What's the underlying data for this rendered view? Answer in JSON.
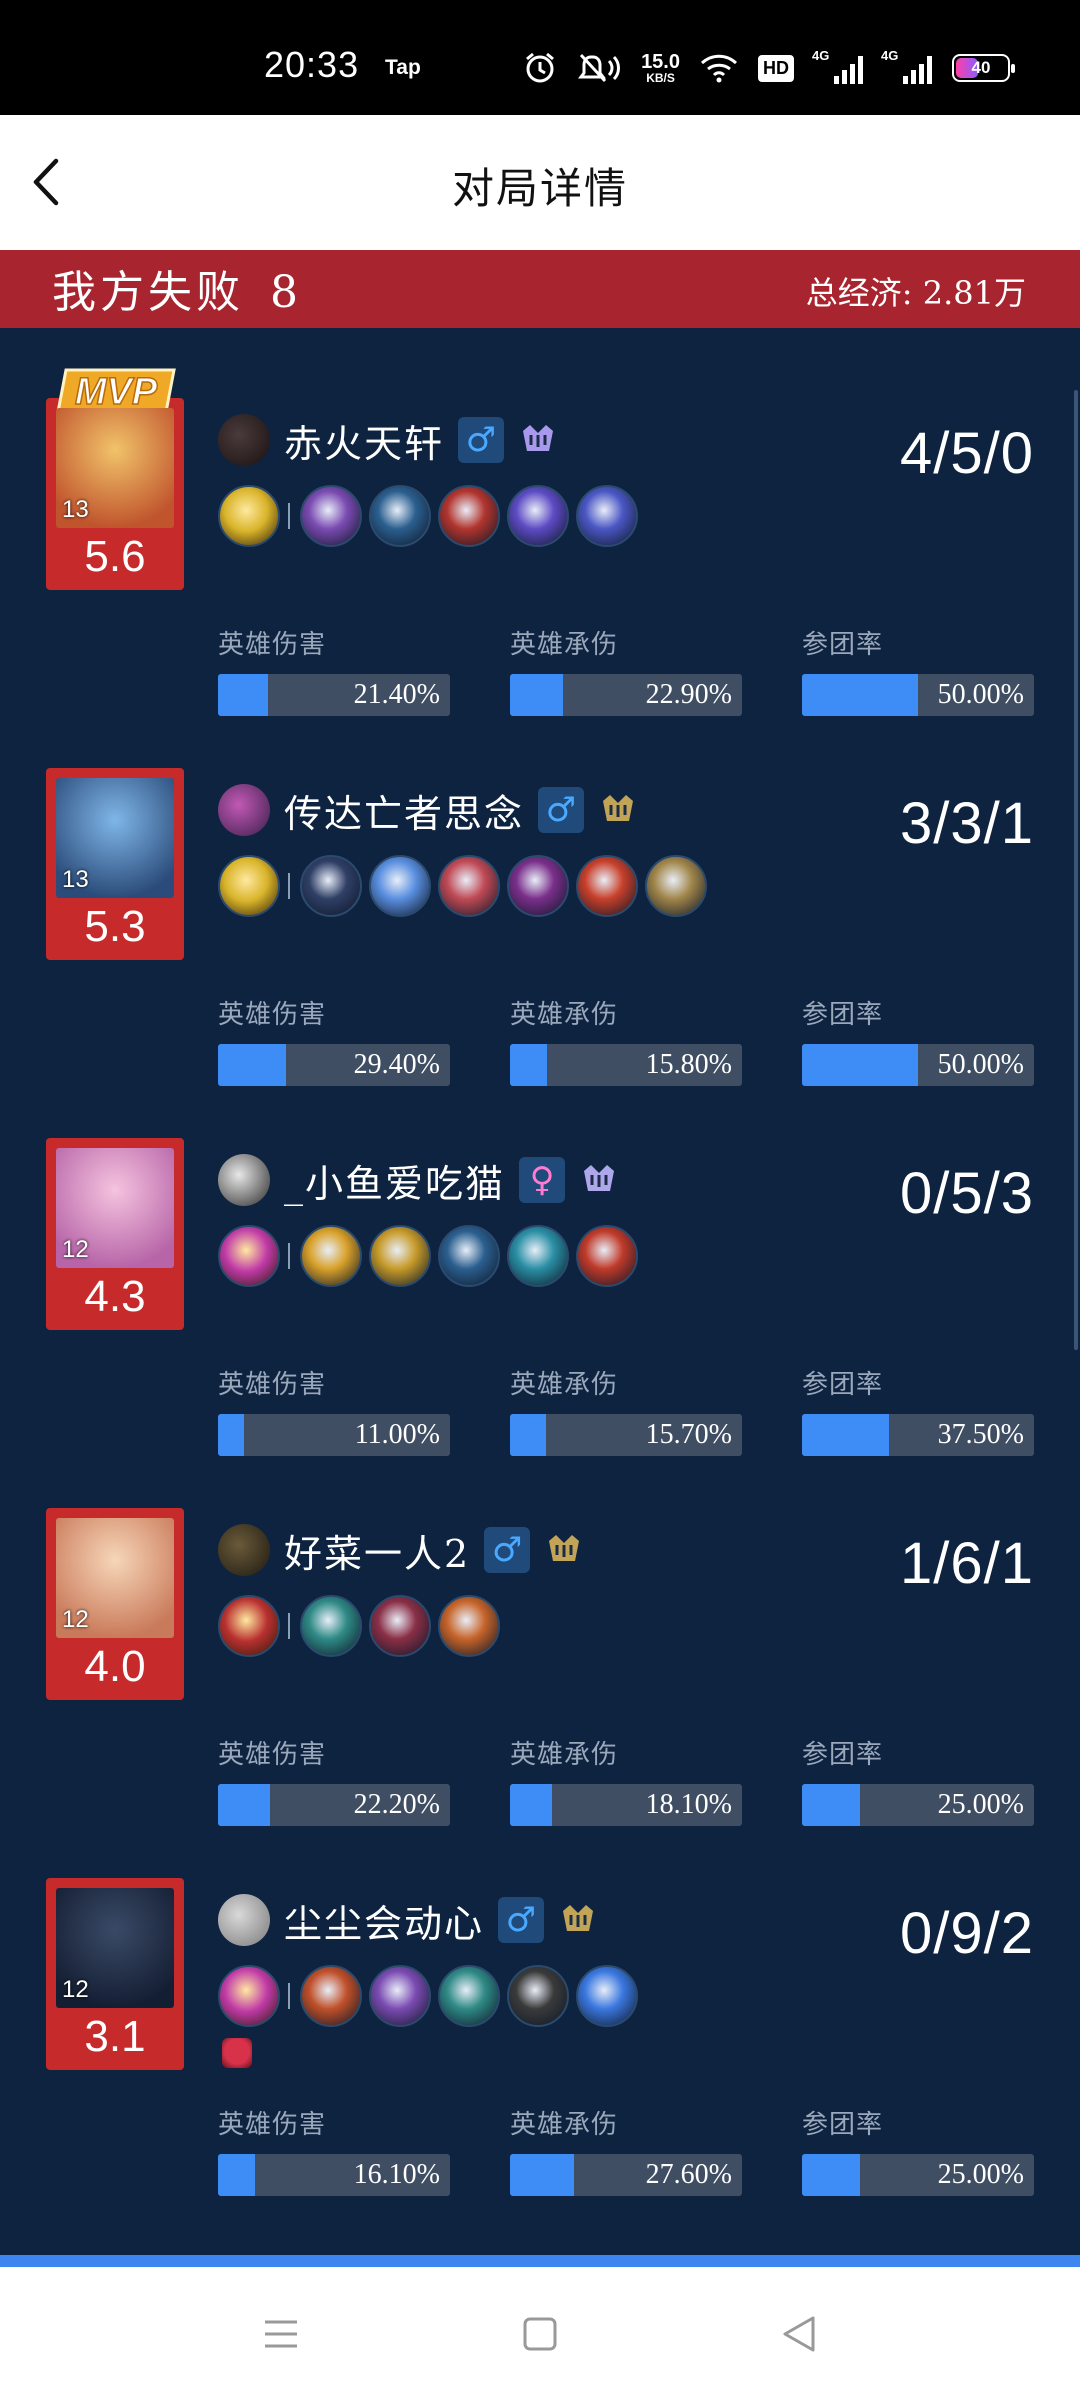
{
  "status_bar": {
    "time": "20:33",
    "app_badge": "Tap",
    "speed_value": "15.0",
    "speed_unit": "KB/S",
    "hd": "HD",
    "net1": "4G",
    "net2": "4G",
    "battery": "40"
  },
  "header": {
    "title": "对局详情"
  },
  "result": {
    "label": "我方失败",
    "count": "8",
    "economy": "总经济: 2.81万"
  },
  "stat_labels": {
    "damage": "英雄伤害",
    "taken": "英雄承伤",
    "participation": "参团率"
  },
  "mvp_label": "MVP",
  "players": [
    {
      "name": "赤火天轩",
      "gender": "♂",
      "gender_type": "male",
      "level": "13",
      "score": "5.6",
      "kda": "4/5/0",
      "mvp": true,
      "hero_colors": [
        "#f1c36a",
        "#c0542d"
      ],
      "avatar_colors": [
        "#4a3b3b",
        "#1a1010"
      ],
      "rank_color": "#b9a6ff",
      "spell": "#d9b42a",
      "items": [
        "#7b4bb2",
        "#2b5f8f",
        "#b2352e",
        "#5d4bc4",
        "#4b57c4"
      ],
      "damage": "21.40%",
      "damage_pct": 0.214,
      "taken": "22.90%",
      "taken_pct": 0.229,
      "participation": "50.00%",
      "participation_pct": 0.5
    },
    {
      "name": "传达亡者思念",
      "gender": "♂",
      "gender_type": "male",
      "level": "13",
      "score": "5.3",
      "kda": "3/3/1",
      "mvp": false,
      "hero_colors": [
        "#7fb6e8",
        "#2b4c7a"
      ],
      "avatar_colors": [
        "#c259b5",
        "#3a1f4a"
      ],
      "rank_color": "#d6b35a",
      "spell": "#d9b42a",
      "items": [
        "#2f3f66",
        "#5a8fe0",
        "#c04a55",
        "#7a2f8a",
        "#c8402b",
        "#a1864a"
      ],
      "damage": "29.40%",
      "damage_pct": 0.294,
      "taken": "15.80%",
      "taken_pct": 0.158,
      "participation": "50.00%",
      "participation_pct": 0.5
    },
    {
      "name": "_小鱼爱吃猫",
      "gender": "♀",
      "gender_type": "female",
      "level": "12",
      "score": "4.3",
      "kda": "0/5/3",
      "mvp": false,
      "hero_colors": [
        "#f5c3df",
        "#b765a8"
      ],
      "avatar_colors": [
        "#e8e8e8",
        "#2a2a2a"
      ],
      "rank_color": "#c0b6ff",
      "spell": "#c03aa7",
      "items": [
        "#d9a12a",
        "#c79b2a",
        "#2b5f8f",
        "#2a8fa5",
        "#c03a2a"
      ],
      "damage": "11.00%",
      "damage_pct": 0.11,
      "taken": "15.70%",
      "taken_pct": 0.157,
      "participation": "37.50%",
      "participation_pct": 0.375
    },
    {
      "name": "好菜一人2",
      "gender": "♂",
      "gender_type": "male",
      "level": "12",
      "score": "4.0",
      "kda": "1/6/1",
      "mvp": false,
      "hero_colors": [
        "#f6d6b8",
        "#c97a5a"
      ],
      "avatar_colors": [
        "#6b5a3a",
        "#1d1a10"
      ],
      "rank_color": "#d6b35a",
      "spell": "#b83030",
      "items": [
        "#2f8a86",
        "#8a2f46",
        "#c7642a"
      ],
      "damage": "22.20%",
      "damage_pct": 0.222,
      "taken": "18.10%",
      "taken_pct": 0.181,
      "participation": "25.00%",
      "participation_pct": 0.25
    },
    {
      "name": "尘尘会动心",
      "gender": "♂",
      "gender_type": "male",
      "level": "12",
      "score": "3.1",
      "kda": "0/9/2",
      "mvp": false,
      "hero_colors": [
        "#3a4a66",
        "#141e33"
      ],
      "avatar_colors": [
        "#d9d9d9",
        "#7a7a7a"
      ],
      "rank_color": "#d6b35a",
      "spell": "#c03aa7",
      "items": [
        "#c0502a",
        "#7b4bb2",
        "#2f8a86",
        "#3a3a3a",
        "#3b78e0"
      ],
      "extra_item": "#d8324b",
      "damage": "16.10%",
      "damage_pct": 0.161,
      "taken": "27.60%",
      "taken_pct": 0.276,
      "participation": "25.00%",
      "participation_pct": 0.25
    }
  ]
}
